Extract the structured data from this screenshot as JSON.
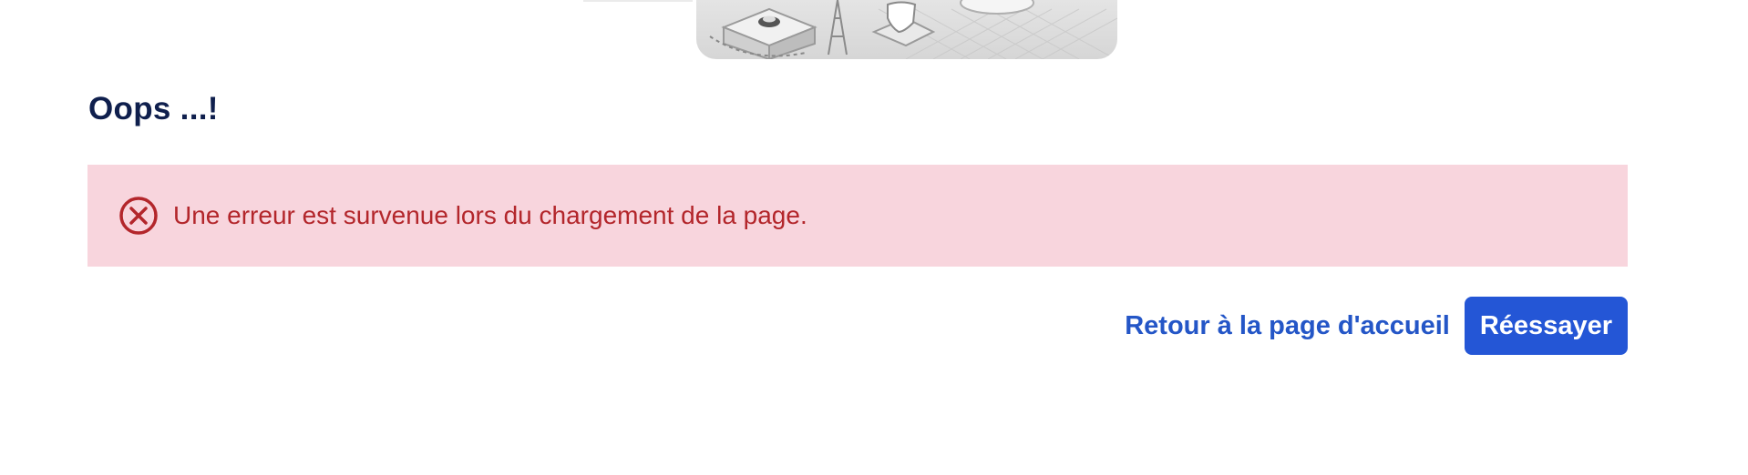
{
  "page": {
    "title": "Oops ...!"
  },
  "alert": {
    "icon": "error-circle-x-icon",
    "message": "Une erreur est survenue lors du chargement de la page.",
    "background_color": "#f8d5dd",
    "text_color": "#b3262b"
  },
  "actions": {
    "home_link_label": "Retour à la page d'accueil",
    "retry_label": "Réessayer",
    "link_color": "#2456c7",
    "primary_color": "#2456d6"
  },
  "illustration": {
    "icon": "isometric-server-illustration-icon"
  }
}
